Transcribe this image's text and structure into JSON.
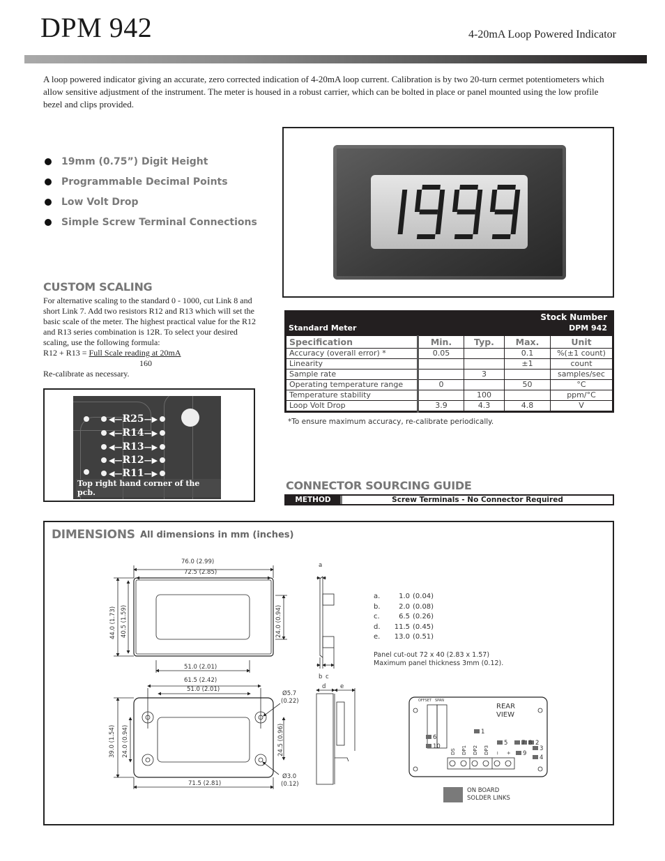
{
  "header": {
    "title": "DPM 942",
    "subtitle": "4-20mA Loop Powered Indicator"
  },
  "intro": "A loop powered indicator giving an accurate, zero corrected indication of 4-20mA loop current.  Calibration is by two 20-turn cermet potentiometers which allow sensitive adjustment of the instrument.  The meter is housed in a robust carrier, which can be bolted in place or panel mounted using the low profile bezel and clips provided.",
  "features": [
    "19mm (0.75”) Digit Height",
    "Programmable Decimal Points",
    "Low Volt Drop",
    "Simple Screw Terminal Connections"
  ],
  "meter_display": {
    "reading": "1999"
  },
  "custom_scaling": {
    "title": "CUSTOM SCALING",
    "body": "For alternative scaling to the standard 0 - 1000, cut Link 8 and short Link 7.  Add two resistors R12 and R13 which will set the basic scale of the meter.  The highest practical value for the R12 and R13 series combination is 12R.  To select your desired scaling, use the following formula:",
    "formula_lhs": "R12 + R13 = ",
    "formula_numerator": "Full Scale reading at 20mA",
    "formula_denominator": "160",
    "footer": "Re-calibrate as necessary."
  },
  "pcb_photo": {
    "labels": [
      "R25",
      "R14",
      "R13",
      "R12",
      "R11"
    ],
    "caption": "Top right hand corner of the pcb."
  },
  "spec_table": {
    "header_left": "Standard Meter",
    "stock_label": "Stock Number",
    "stock_code": "DPM 942",
    "columns": [
      "Specification",
      "Min.",
      "Typ.",
      "Max.",
      "Unit"
    ],
    "rows": [
      [
        "Accuracy (overall error) *",
        "0.05",
        "",
        "0.1",
        "%(±1 count)"
      ],
      [
        "Linearity",
        "",
        "",
        "±1",
        "count"
      ],
      [
        "Sample rate",
        "",
        "3",
        "",
        "samples/sec"
      ],
      [
        "Operating temperature range",
        "0",
        "",
        "50",
        "°C"
      ],
      [
        "Temperature stability",
        "",
        "100",
        "",
        "ppm/°C"
      ],
      [
        "Loop Volt Drop",
        "3.9",
        "4.3",
        "4.8",
        "V"
      ]
    ],
    "note": "*To ensure maximum accuracy, re-calibrate periodically."
  },
  "connector_guide": {
    "title": "CONNECTOR SOURCING GUIDE",
    "method_label": "METHOD",
    "method_value": "Screw Terminals - No Connector Required"
  },
  "dimensions": {
    "title": "DIMENSIONS",
    "subtitle": "All dimensions in mm (inches)",
    "front": {
      "w_outer": "76.0  (2.99)",
      "w_inner": "72.5  (2.85)",
      "h_outer": "44.0  (1.73)",
      "h_inner": "40.5  (1.59)",
      "window_h": "24.0  (0.94)",
      "window_w": "51.0  (2.01)"
    },
    "rear": {
      "hole_span": "61.5  (2.42)",
      "window_w": "51.0  (2.01)",
      "h_outer": "39.0  (1.54)",
      "window_h": "24.0  (0.94)",
      "hole_v": "24.5  (0.96)",
      "w_outer": "71.5  (2.81)",
      "big_hole": "Ø5.7",
      "big_hole_in": "(0.22)",
      "small_hole": "Ø3.0",
      "small_hole_in": "(0.12)"
    },
    "side_labels": {
      "a": "a",
      "b": "b",
      "c": "c",
      "d": "d",
      "e": "e"
    },
    "side_values": [
      {
        "k": "a.",
        "mm": "1.0",
        "in": "(0.04)"
      },
      {
        "k": "b.",
        "mm": "2.0",
        "in": "(0.08)"
      },
      {
        "k": "c.",
        "mm": "6.5",
        "in": "(0.26)"
      },
      {
        "k": "d.",
        "mm": "11.5",
        "in": "(0.45)"
      },
      {
        "k": "e.",
        "mm": "13.0",
        "in": "(0.51)"
      }
    ],
    "panel_cutout": "Panel  cut-out  72  x  40  (2.83  x  1.57)",
    "panel_thickness": "Maximum  panel  thickness  3mm  (0.12).",
    "rear_view": {
      "title_1": "REAR",
      "title_2": "VIEW",
      "pot_labels": [
        "OFFSET",
        "SPAN"
      ],
      "links": [
        "1",
        "2",
        "3",
        "4",
        "5",
        "6",
        "7",
        "8",
        "9",
        "10"
      ],
      "terminals": [
        "DS",
        "DP1",
        "DP2",
        "DP3",
        "−",
        "+"
      ]
    },
    "legend": [
      "ON BOARD",
      "SOLDER LINKS"
    ]
  }
}
